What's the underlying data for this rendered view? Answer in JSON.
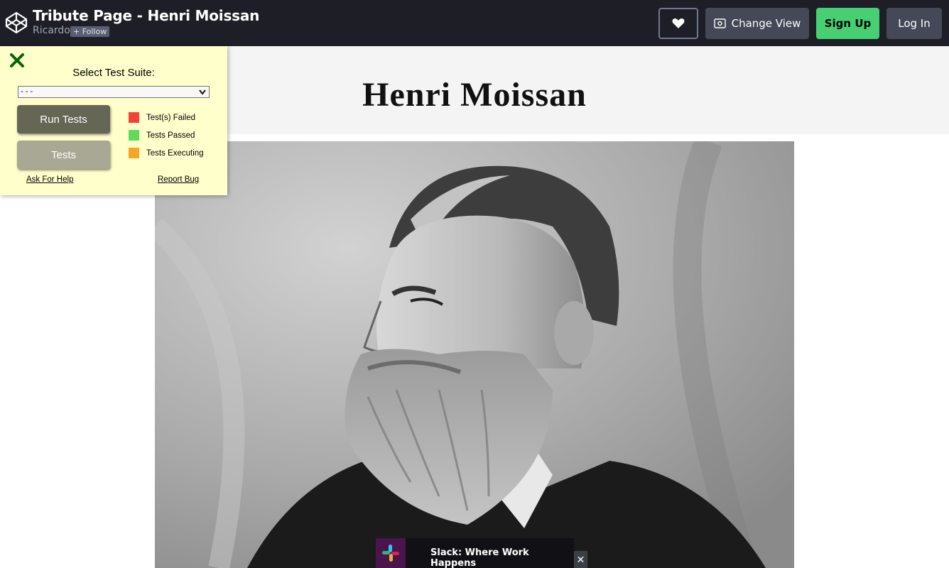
{
  "topbar": {
    "title": "Tribute Page - Henri Moissan",
    "author": "Ricardo",
    "follow_label": "+ Follow",
    "change_view_label": "Change View",
    "signup_label": "Sign Up",
    "login_label": "Log In"
  },
  "page": {
    "heading": "Henri Moissan"
  },
  "test_panel": {
    "suite_label": "Select Test Suite:",
    "suite_selected": "- - -",
    "run_label": "Run Tests",
    "tests_label": "Tests",
    "legend": [
      {
        "label": "Test(s) Failed",
        "color": "#f44336"
      },
      {
        "label": "Tests Passed",
        "color": "#5fdb58"
      },
      {
        "label": "Tests Executing",
        "color": "#f6a623"
      }
    ],
    "help_label": "Ask For Help",
    "bug_label": "Report Bug"
  },
  "ad": {
    "text": "Slack: Where Work Happens",
    "close_label": "✕"
  },
  "colors": {
    "topbar_bg": "#1e1f26",
    "signup_green": "#47cf73",
    "panel_bg": "#ffffcc",
    "close_green": "#006600"
  },
  "icons": [
    "codepen-logo-icon",
    "heart-icon",
    "eye-icon",
    "close-icon",
    "chevron-down-icon",
    "slack-logo-icon"
  ]
}
